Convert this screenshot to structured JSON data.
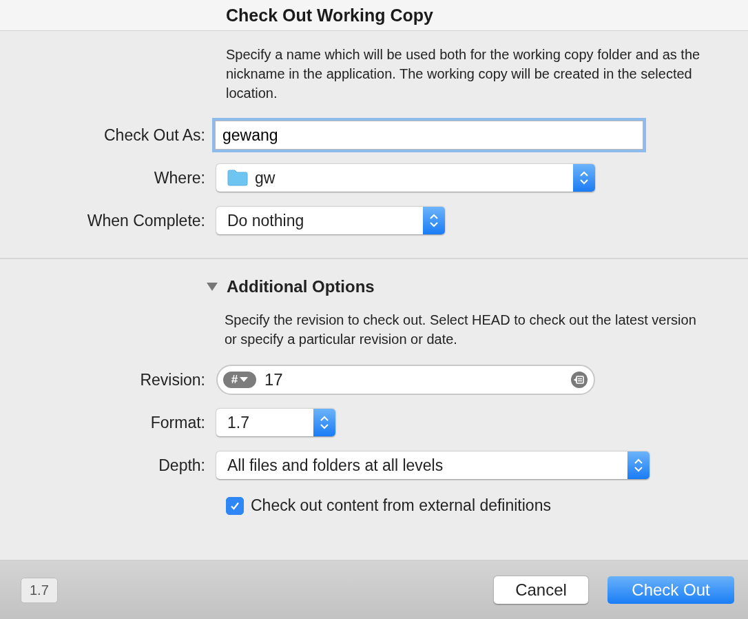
{
  "window": {
    "title": "Check Out Working Copy"
  },
  "main": {
    "description": "Specify a name which will be used both for the working copy folder and as the nickname in the application. The working copy will be created in the selected location.",
    "rows": [
      {
        "kind": "text",
        "label": "Check Out As:",
        "value": "gewang",
        "focused": true
      },
      {
        "kind": "popup",
        "label": "Where:",
        "value": "gw",
        "folder": true
      },
      {
        "kind": "popup",
        "label": "When Complete:",
        "value": "Do nothing"
      }
    ]
  },
  "additional": {
    "title": "Additional Options",
    "expanded": true,
    "description": "Specify the revision to check out. Select HEAD to check out the latest version or specify a particular revision or date.",
    "rows": [
      {
        "kind": "revision",
        "label": "Revision:",
        "badge": "#",
        "value": "17"
      },
      {
        "kind": "popup",
        "label": "Format:",
        "value": "1.7"
      },
      {
        "kind": "popup",
        "label": "Depth:",
        "value": "All files and folders at all levels"
      }
    ],
    "checkbox": {
      "label": "Check out content from external definitions",
      "checked": true
    }
  },
  "footer": {
    "version": "1.7",
    "buttons": [
      {
        "label": "Cancel",
        "kind": "secondary"
      },
      {
        "label": "Check Out",
        "kind": "primary"
      }
    ]
  }
}
